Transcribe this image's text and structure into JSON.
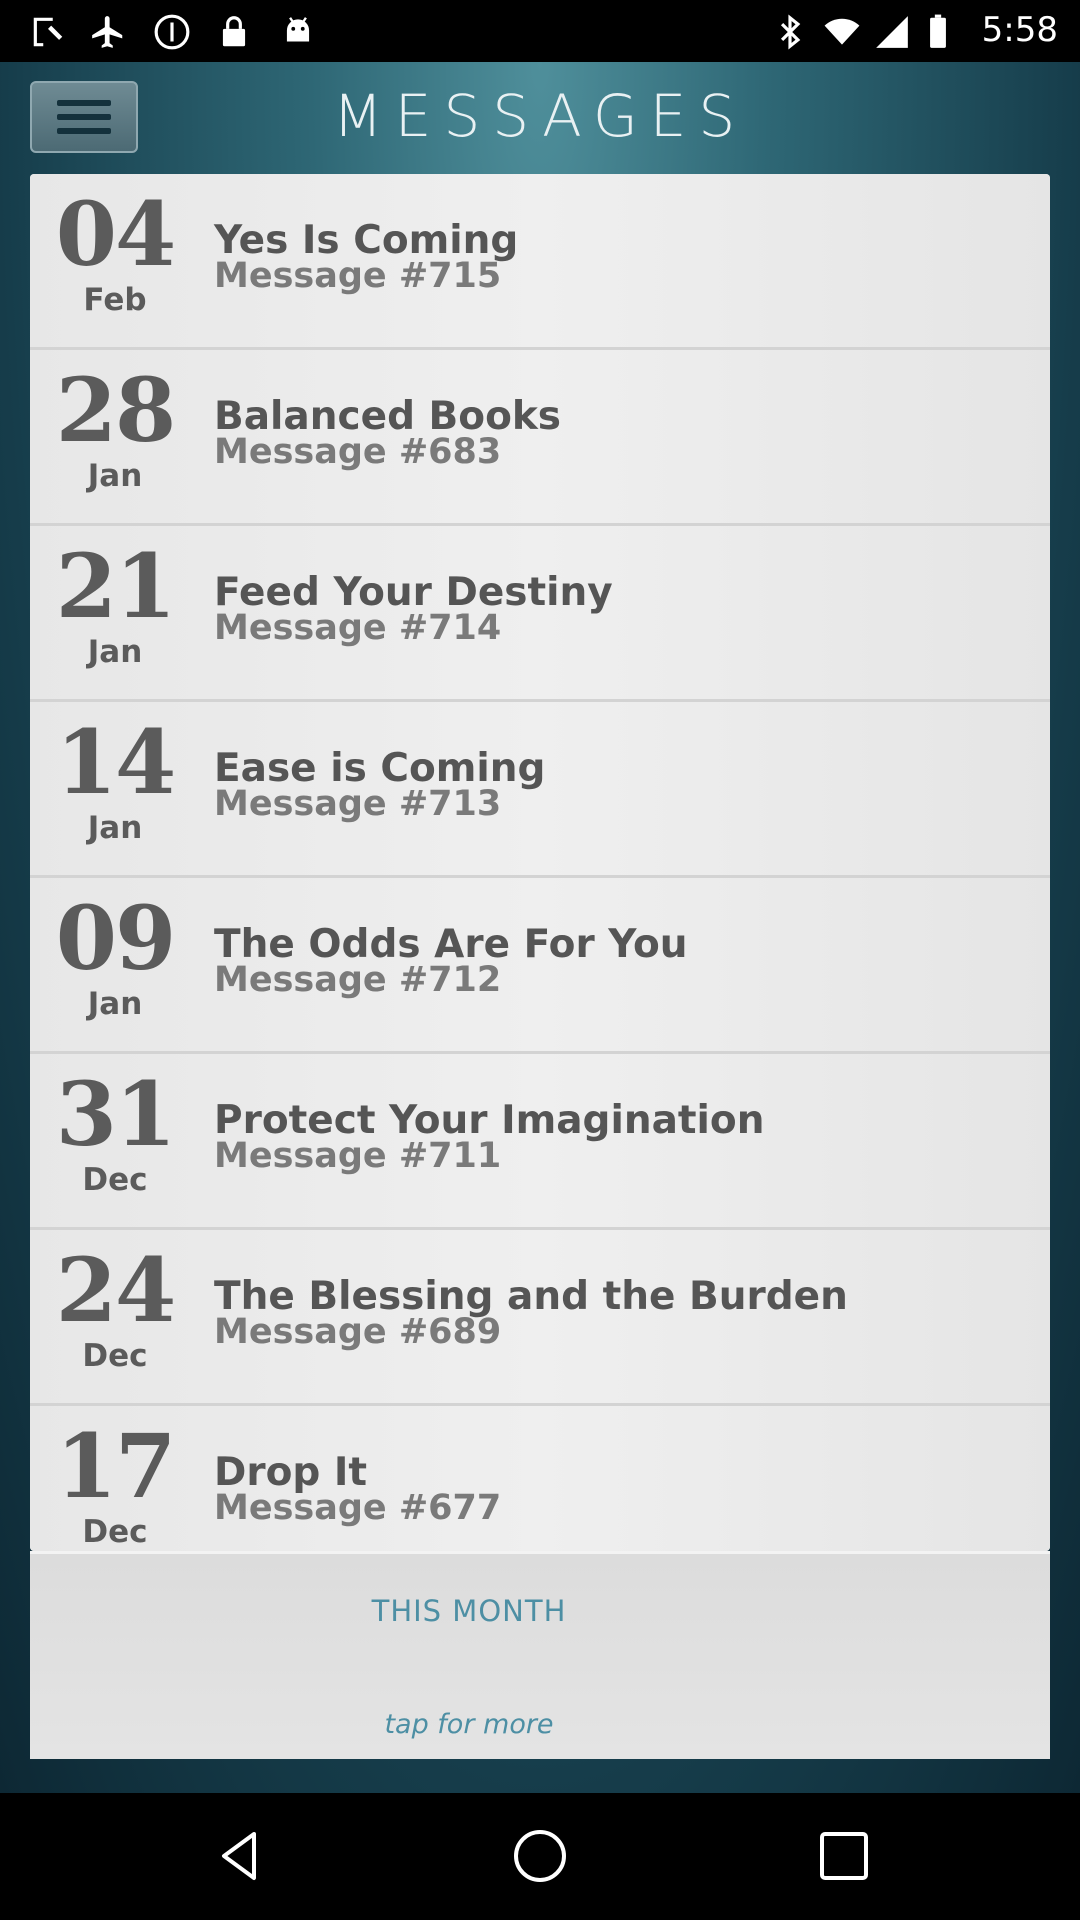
{
  "status_bar": {
    "time": "5:58",
    "left_icons": [
      "fake-gps-icon",
      "airplane-tool-icon",
      "alert-circle-icon",
      "lock-icon",
      "android-icon"
    ],
    "right_icons": [
      "bluetooth-icon",
      "wifi-icon",
      "signal-icon",
      "battery-icon"
    ]
  },
  "header": {
    "title": "MESSAGES",
    "menu_icon": "hamburger-menu-icon"
  },
  "messages": [
    {
      "day": "04",
      "month": "Feb",
      "title": "Yes Is Coming",
      "subtitle": "Message #715"
    },
    {
      "day": "28",
      "month": "Jan",
      "title": "Balanced Books",
      "subtitle": "Message #683"
    },
    {
      "day": "21",
      "month": "Jan",
      "title": "Feed Your Destiny",
      "subtitle": "Message #714"
    },
    {
      "day": "14",
      "month": "Jan",
      "title": "Ease is Coming",
      "subtitle": "Message #713"
    },
    {
      "day": "09",
      "month": "Jan",
      "title": "The Odds Are For You",
      "subtitle": "Message #712"
    },
    {
      "day": "31",
      "month": "Dec",
      "title": "Protect Your Imagination",
      "subtitle": "Message #711"
    },
    {
      "day": "24",
      "month": "Dec",
      "title": "The Blessing and the Burden",
      "subtitle": "Message #689"
    },
    {
      "day": "17",
      "month": "Dec",
      "title": "Drop It",
      "subtitle": "Message #677"
    }
  ],
  "footer": {
    "title": "THIS MONTH",
    "more": "tap for more"
  },
  "nav_bar": {
    "icons": [
      "back-icon",
      "home-icon",
      "recents-icon"
    ]
  },
  "colors": {
    "accent": "#4d8fa4",
    "header_bg": "#2e6775"
  }
}
